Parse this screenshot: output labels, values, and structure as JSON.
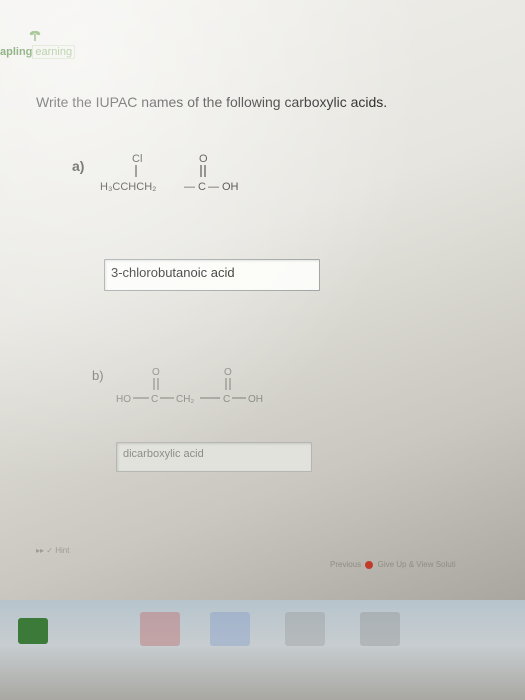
{
  "logo": {
    "part1": "apling",
    "part2": "earning"
  },
  "prompt": "Write the IUPAC names of the following carboxylic acids.",
  "question_a": {
    "label": "a)",
    "structure": {
      "substituent": "Cl",
      "oxygen": "O",
      "main": "H₃CCHCH₂",
      "bond": "—",
      "carbon": "C",
      "end": "OH"
    },
    "answer": "3-chlorobutanoic acid"
  },
  "question_b": {
    "label": "b)",
    "structure": {
      "oxygen": "O",
      "start": "HO",
      "carbon": "C",
      "middle": "CH₂",
      "end": "OH"
    },
    "answer": "dicarboxylic acid"
  },
  "footer": {
    "hint": "Hint",
    "previous": "Previous",
    "give_up": "Give Up & View Soluti"
  }
}
